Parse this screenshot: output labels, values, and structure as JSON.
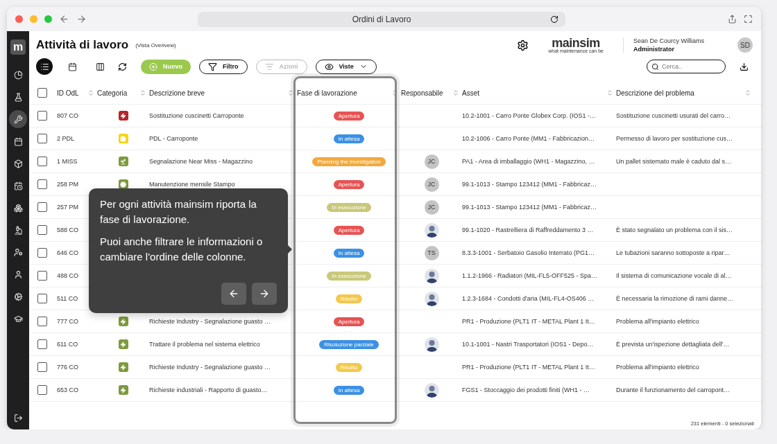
{
  "browser": {
    "title": "Ordini di Lavoro"
  },
  "sidebar": {
    "logo": "m",
    "items": [
      {
        "selected": false
      },
      {
        "selected": false
      },
      {
        "selected": true
      },
      {
        "selected": false
      },
      {
        "selected": false
      },
      {
        "selected": false
      },
      {
        "selected": false
      },
      {
        "selected": false
      },
      {
        "selected": false
      },
      {
        "selected": false
      },
      {
        "selected": false
      },
      {
        "selected": false
      }
    ]
  },
  "header": {
    "title": "Attività di lavoro",
    "subtitle": "(Vista Overivew)",
    "brand": "mainsim",
    "brand_tagline": "what maintenance can be",
    "user_name": "Sean De Courcy Williams",
    "user_role": "Administrator",
    "avatar": "SD"
  },
  "toolbar": {
    "views": [
      {
        "selected": true
      },
      {
        "selected": false
      },
      {
        "selected": false
      }
    ],
    "buttons": [
      {
        "kind": "new",
        "label": "Nuovo",
        "disabled": false
      },
      {
        "kind": "filter",
        "label": "Filtro",
        "disabled": false
      },
      {
        "kind": "actions",
        "label": "Azioni",
        "disabled": true
      },
      {
        "kind": "views",
        "label": "Viste",
        "disabled": false
      }
    ],
    "search": {
      "placeholder": "Cerca.."
    }
  },
  "table": {
    "select_all_checked": false,
    "columns": [
      "ID OdL",
      "Categoria",
      "Descrizione breve",
      "Fase di lavorazione",
      "Responsabile",
      "Asset",
      "Descrizione del problema"
    ],
    "rows": [
      {
        "checked": false,
        "id": "807 CO",
        "category": {
          "kind": "bolt",
          "color": "#b3262b"
        },
        "description": "Sostituzione cuscinetti Carroponte",
        "phase": {
          "label": "Apertura",
          "color": "#e65454"
        },
        "asset": "10.2-1001 - Carro Ponte Globex Corp. (IOS1 -…",
        "problem": "Sostituzione cuscinetti usurati del carro…"
      },
      {
        "checked": false,
        "id": "2 PDL",
        "category": {
          "kind": "note",
          "color": "#f5d416"
        },
        "description": "PDL - Carroponte",
        "phase": {
          "label": "In attesa",
          "color": "#3b91e3"
        },
        "asset": "10.2-1006 - Carro Ponte (MM1 - Fabbricazion…",
        "problem": "Permesso di lavoro per sostituzione cus…"
      },
      {
        "checked": false,
        "id": "1 MISS",
        "category": {
          "kind": "leaf",
          "color": "#7d9a3c"
        },
        "description": "Segnalazione Near Miss - Magazzino",
        "phase": {
          "label": "Planning the investigation",
          "color": "#f2a93b"
        },
        "owner": {
          "kind": "initials",
          "text": "JC"
        },
        "asset": "PA1 - Area di imballaggio (WH1 - Magazzino, …",
        "problem": "Un pallet sistemato male è caduto dal s…"
      },
      {
        "checked": false,
        "id": "258 PM",
        "category": {
          "kind": "clock",
          "color": "#7d9a3c"
        },
        "description": "Manutenzione mensile Stampo",
        "phase": {
          "label": "Apertura",
          "color": "#e65454"
        },
        "owner": {
          "kind": "initials",
          "text": "JC"
        },
        "asset": "99.1-1013 - Stampo 123412 (MM1 - Fabbricaz…"
      },
      {
        "checked": false,
        "id": "257 PM",
        "phase": {
          "label": "In esecuzione",
          "color": "#c9c878"
        },
        "owner": {
          "kind": "initials",
          "text": "JC"
        },
        "asset": "99.1-1013 - Stampo 123412 (MM1 - Fabbricaz…"
      },
      {
        "checked": false,
        "id": "588 CO",
        "phase": {
          "label": "Apertura",
          "color": "#e65454"
        },
        "owner": {
          "kind": "photo"
        },
        "asset": "99.1-1020 - Rastrelliera di Raffreddamento 3 …",
        "problem": "È stato segnalato un problema con il sis…"
      },
      {
        "checked": false,
        "id": "646 CO",
        "phase": {
          "label": "In attesa",
          "color": "#3b91e3"
        },
        "owner": {
          "kind": "initials",
          "text": "TS"
        },
        "asset": "8.3.3-1001 - Serbatoio Gasolio Interrato (PG1…",
        "problem": "Le tubazioni saranno sottoposte a ripar…"
      },
      {
        "checked": false,
        "id": "488 CO",
        "phase": {
          "label": "In esecuzione",
          "color": "#c9c878"
        },
        "owner": {
          "kind": "photo"
        },
        "asset": "1.1.2-1966 - Radiatori (MIL-FL5-OFF525 - Spa…",
        "problem": "Il sistema di comunicazione vocale di al…"
      },
      {
        "checked": false,
        "id": "511 CO",
        "phase": {
          "label": "Risolto",
          "color": "#f2c94c"
        },
        "owner": {
          "kind": "photo"
        },
        "asset": "1.2.3-1684 - Condotti d'aria (MIL-FL4-OS406 …",
        "problem": "È necessaria la rimozione di rami danne…"
      },
      {
        "checked": false,
        "id": "777 CO",
        "category": {
          "kind": "bolt",
          "color": "#7d9a3c"
        },
        "description": "Richieste Industry - Segnalazione guasto …",
        "phase": {
          "label": "Apertura",
          "color": "#e65454"
        },
        "asset": "PR1 - Produzione (PLT1 IT - METAL Plant 1 It…",
        "problem": "Problema all'impianto elettrico"
      },
      {
        "checked": false,
        "id": "611 CO",
        "category": {
          "kind": "bolt",
          "color": "#7d9a3c"
        },
        "description": "Trattare il problema nel sistema elettrico",
        "phase": {
          "label": "Risoluzione parziale",
          "color": "#3b91e3"
        },
        "owner": {
          "kind": "photo"
        },
        "asset": "10.1-1001 - Nastri Trasportatori (IOS1 - Depo…",
        "problem": "È prevista un'ispezione dettagliata dell'…"
      },
      {
        "checked": false,
        "id": "776 CO",
        "category": {
          "kind": "bolt",
          "color": "#7d9a3c"
        },
        "description": "Richieste Industry - Segnalazione guasto …",
        "phase": {
          "label": "Risolto",
          "color": "#f2c94c"
        },
        "asset": "PR1 - Produzione (PLT1 IT - METAL Plant 1 It…",
        "problem": "Problema all'impianto elettrico"
      },
      {
        "checked": false,
        "id": "653 CO",
        "category": {
          "kind": "bolt",
          "color": "#7d9a3c"
        },
        "description": "Richieste industriali - Rapporto di guasto…",
        "phase": {
          "label": "In attesa",
          "color": "#3b91e3"
        },
        "owner": {
          "kind": "photo"
        },
        "asset": "FGS1 - Stoccaggio dei prodotti finiti (WH1 - …",
        "problem": "Durante il funzionamento del carropont…"
      }
    ],
    "footer": "231 elementi - 0 selezionati"
  },
  "tooltip": {
    "paragraphs": [
      "Per ogni attività mainsim riporta la fase di lavorazione.",
      "Puoi anche filtrare le informazioni o cambiare l'ordine delle colonne."
    ],
    "buttons": [
      {
        "kind": "prev"
      },
      {
        "kind": "next"
      }
    ]
  }
}
